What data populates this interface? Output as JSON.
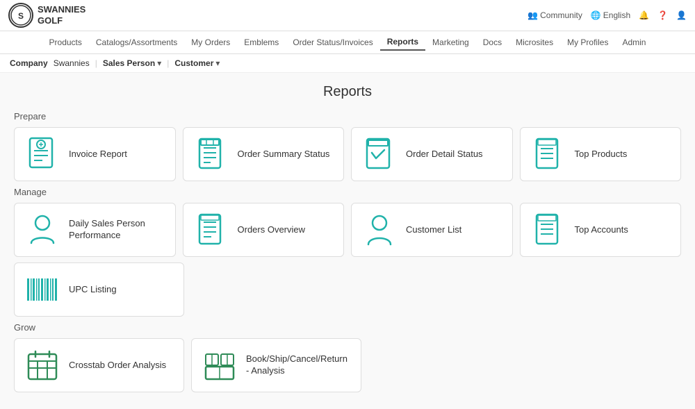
{
  "logo": {
    "circle_text": "S",
    "line1": "SWANNIES",
    "line2": "GOLF"
  },
  "top_right": {
    "community": "Community",
    "language": "English",
    "icons": [
      "bell",
      "question",
      "user"
    ]
  },
  "main_nav": [
    {
      "label": "Products",
      "active": false
    },
    {
      "label": "Catalogs/Assortments",
      "active": false
    },
    {
      "label": "My Orders",
      "active": false
    },
    {
      "label": "Emblems",
      "active": false
    },
    {
      "label": "Order Status/Invoices",
      "active": false
    },
    {
      "label": "Reports",
      "active": true
    },
    {
      "label": "Marketing",
      "active": false
    },
    {
      "label": "Docs",
      "active": false
    },
    {
      "label": "Microsites",
      "active": false
    },
    {
      "label": "My Profiles",
      "active": false
    },
    {
      "label": "Admin",
      "active": false
    }
  ],
  "sub_nav": {
    "company_label": "Company",
    "company_value": "Swannies",
    "sales_person_label": "Sales Person",
    "customer_label": "Customer"
  },
  "page_title": "Reports",
  "sections": [
    {
      "label": "Prepare",
      "cards": [
        {
          "id": "invoice-report",
          "label": "Invoice Report",
          "icon": "invoice"
        },
        {
          "id": "order-summary-status",
          "label": "Order Summary Status",
          "icon": "order-summary"
        },
        {
          "id": "order-detail-status",
          "label": "Order Detail Status",
          "icon": "order-detail"
        },
        {
          "id": "top-products",
          "label": "Top Products",
          "icon": "top-products"
        }
      ]
    },
    {
      "label": "Manage",
      "cards": [
        {
          "id": "daily-sales",
          "label": "Daily Sales Person Performance",
          "icon": "person"
        },
        {
          "id": "orders-overview",
          "label": "Orders Overview",
          "icon": "orders-overview"
        },
        {
          "id": "customer-list",
          "label": "Customer List",
          "icon": "customer"
        },
        {
          "id": "top-accounts",
          "label": "Top Accounts",
          "icon": "top-accounts"
        }
      ]
    },
    {
      "label": "Manage_row2",
      "cards": [
        {
          "id": "upc-listing",
          "label": "UPC Listing",
          "icon": "upc"
        }
      ]
    },
    {
      "label": "Grow",
      "cards": [
        {
          "id": "crosstab-order",
          "label": "Crosstab Order Analysis",
          "icon": "calendar-grid"
        },
        {
          "id": "book-ship",
          "label": "Book/Ship/Cancel/Return - Analysis",
          "icon": "boxes"
        }
      ]
    }
  ]
}
